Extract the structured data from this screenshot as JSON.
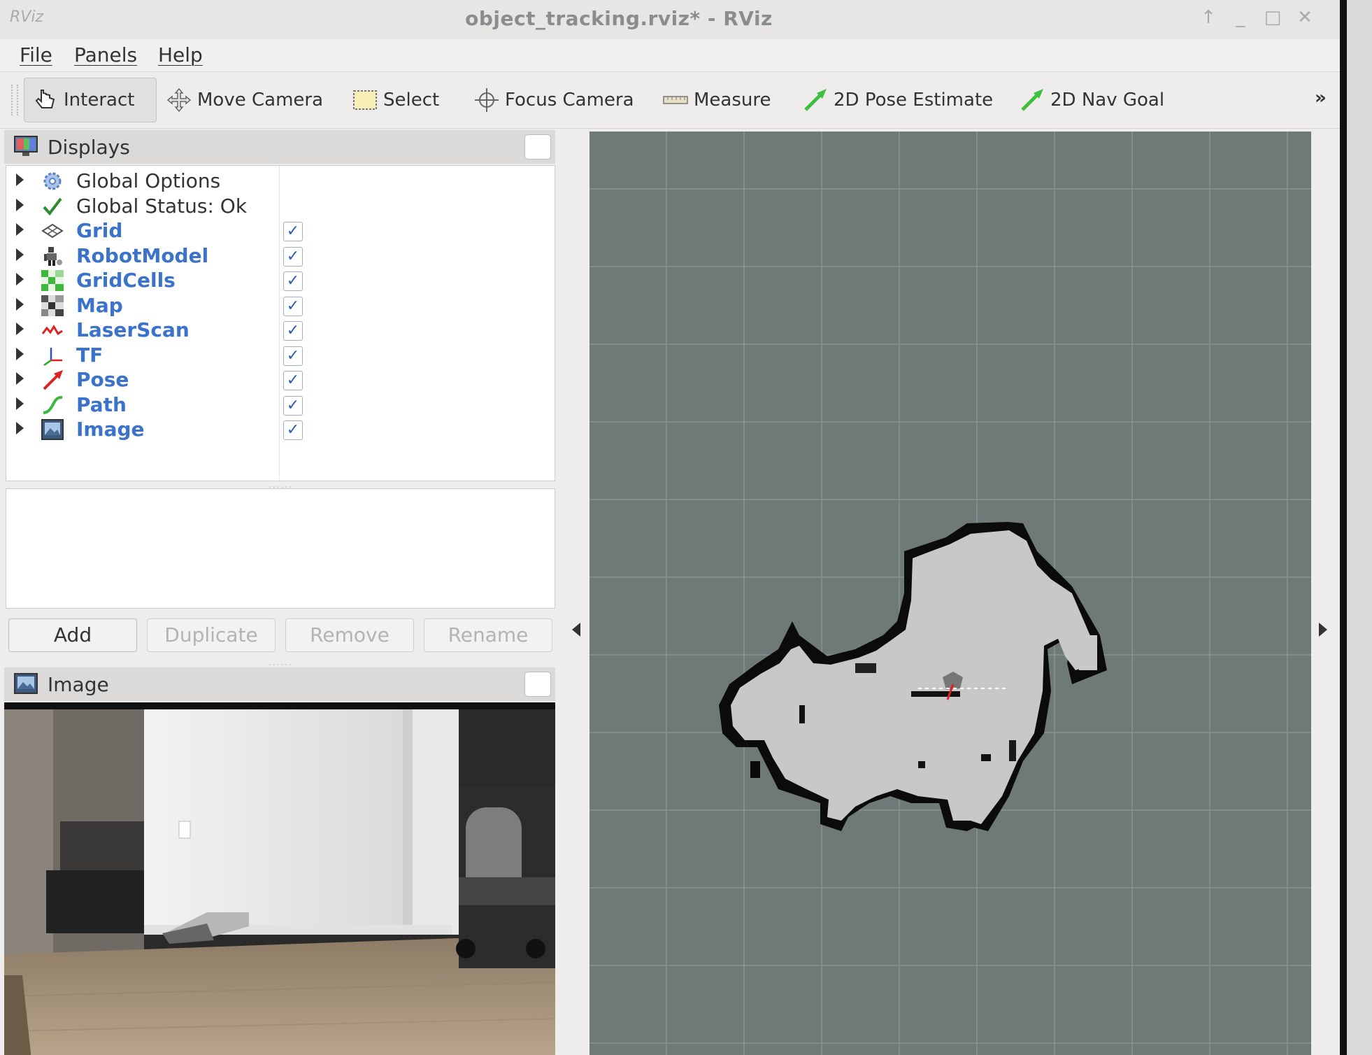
{
  "window": {
    "logo": "RViz",
    "title": "object_tracking.rviz* - RViz"
  },
  "menubar": {
    "items": [
      "File",
      "Panels",
      "Help"
    ]
  },
  "toolbar": {
    "tools": [
      {
        "label": "Interact",
        "icon": "hand-pointer-icon",
        "active": true
      },
      {
        "label": "Move Camera",
        "icon": "move-camera-icon"
      },
      {
        "label": "Select",
        "icon": "select-box-icon"
      },
      {
        "label": "Focus Camera",
        "icon": "crosshair-icon"
      },
      {
        "label": "Measure",
        "icon": "ruler-icon"
      },
      {
        "label": "2D Pose Estimate",
        "icon": "green-arrow-icon"
      },
      {
        "label": "2D Nav Goal",
        "icon": "green-arrow-icon"
      }
    ],
    "overflow": "»"
  },
  "displays_panel": {
    "title": "Displays",
    "items": [
      {
        "label": "Global Options",
        "icon": "gear-icon",
        "checkable": false
      },
      {
        "label": "Global Status: Ok",
        "icon": "checkmark-icon",
        "checkable": false
      },
      {
        "label": "Grid",
        "icon": "grid-icon",
        "checkable": true,
        "checked": true
      },
      {
        "label": "RobotModel",
        "icon": "robot-icon",
        "checkable": true,
        "checked": true
      },
      {
        "label": "GridCells",
        "icon": "gridcells-icon",
        "checkable": true,
        "checked": true
      },
      {
        "label": "Map",
        "icon": "map-icon",
        "checkable": true,
        "checked": true
      },
      {
        "label": "LaserScan",
        "icon": "laserscan-icon",
        "checkable": true,
        "checked": true
      },
      {
        "label": "TF",
        "icon": "tf-axes-icon",
        "checkable": true,
        "checked": true
      },
      {
        "label": "Pose",
        "icon": "pose-arrow-icon",
        "checkable": true,
        "checked": true
      },
      {
        "label": "Path",
        "icon": "path-icon",
        "checkable": true,
        "checked": true
      },
      {
        "label": "Image",
        "icon": "image-icon",
        "checkable": true,
        "checked": true
      }
    ],
    "check_mark": "✓",
    "buttons": {
      "add": "Add",
      "duplicate": "Duplicate",
      "remove": "Remove",
      "rename": "Rename"
    }
  },
  "image_panel": {
    "title": "Image"
  },
  "colors": {
    "view_background": "#6f7978",
    "grid_line": "#8a9392",
    "map_free": "#c8c8c8",
    "map_occupied": "#0a0a0a",
    "display_label": "#3a73c9"
  }
}
